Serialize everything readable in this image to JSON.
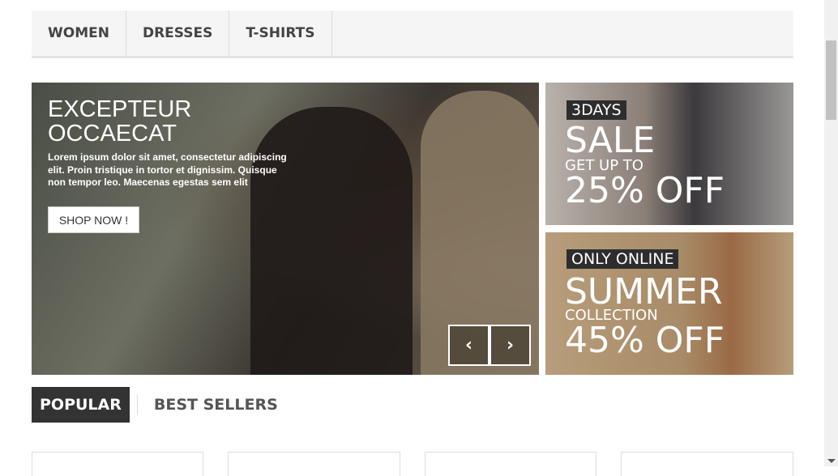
{
  "nav": {
    "items": [
      "WOMEN",
      "DRESSES",
      "T-SHIRTS"
    ]
  },
  "hero": {
    "title_line1": "EXCEPTEUR",
    "title_line2": "OCCAECAT",
    "text": "Lorem ipsum dolor sit amet, consectetur adipiscing elit. Proin tristique in tortor et dignissim. Quisque non tempor leo. Maecenas egestas sem elit",
    "button": "SHOP NOW !",
    "prev": "‹",
    "next": "›"
  },
  "banner1": {
    "tag": "3DAYS",
    "big": "SALE",
    "mid": "GET UP TO",
    "offer": "25% OFF"
  },
  "banner2": {
    "tag": "ONLY ONLINE",
    "big": "SUMMER",
    "mid": "COLLECTION",
    "offer": "45% OFF"
  },
  "tabs": {
    "active": "POPULAR",
    "other": "BEST SELLERS"
  }
}
